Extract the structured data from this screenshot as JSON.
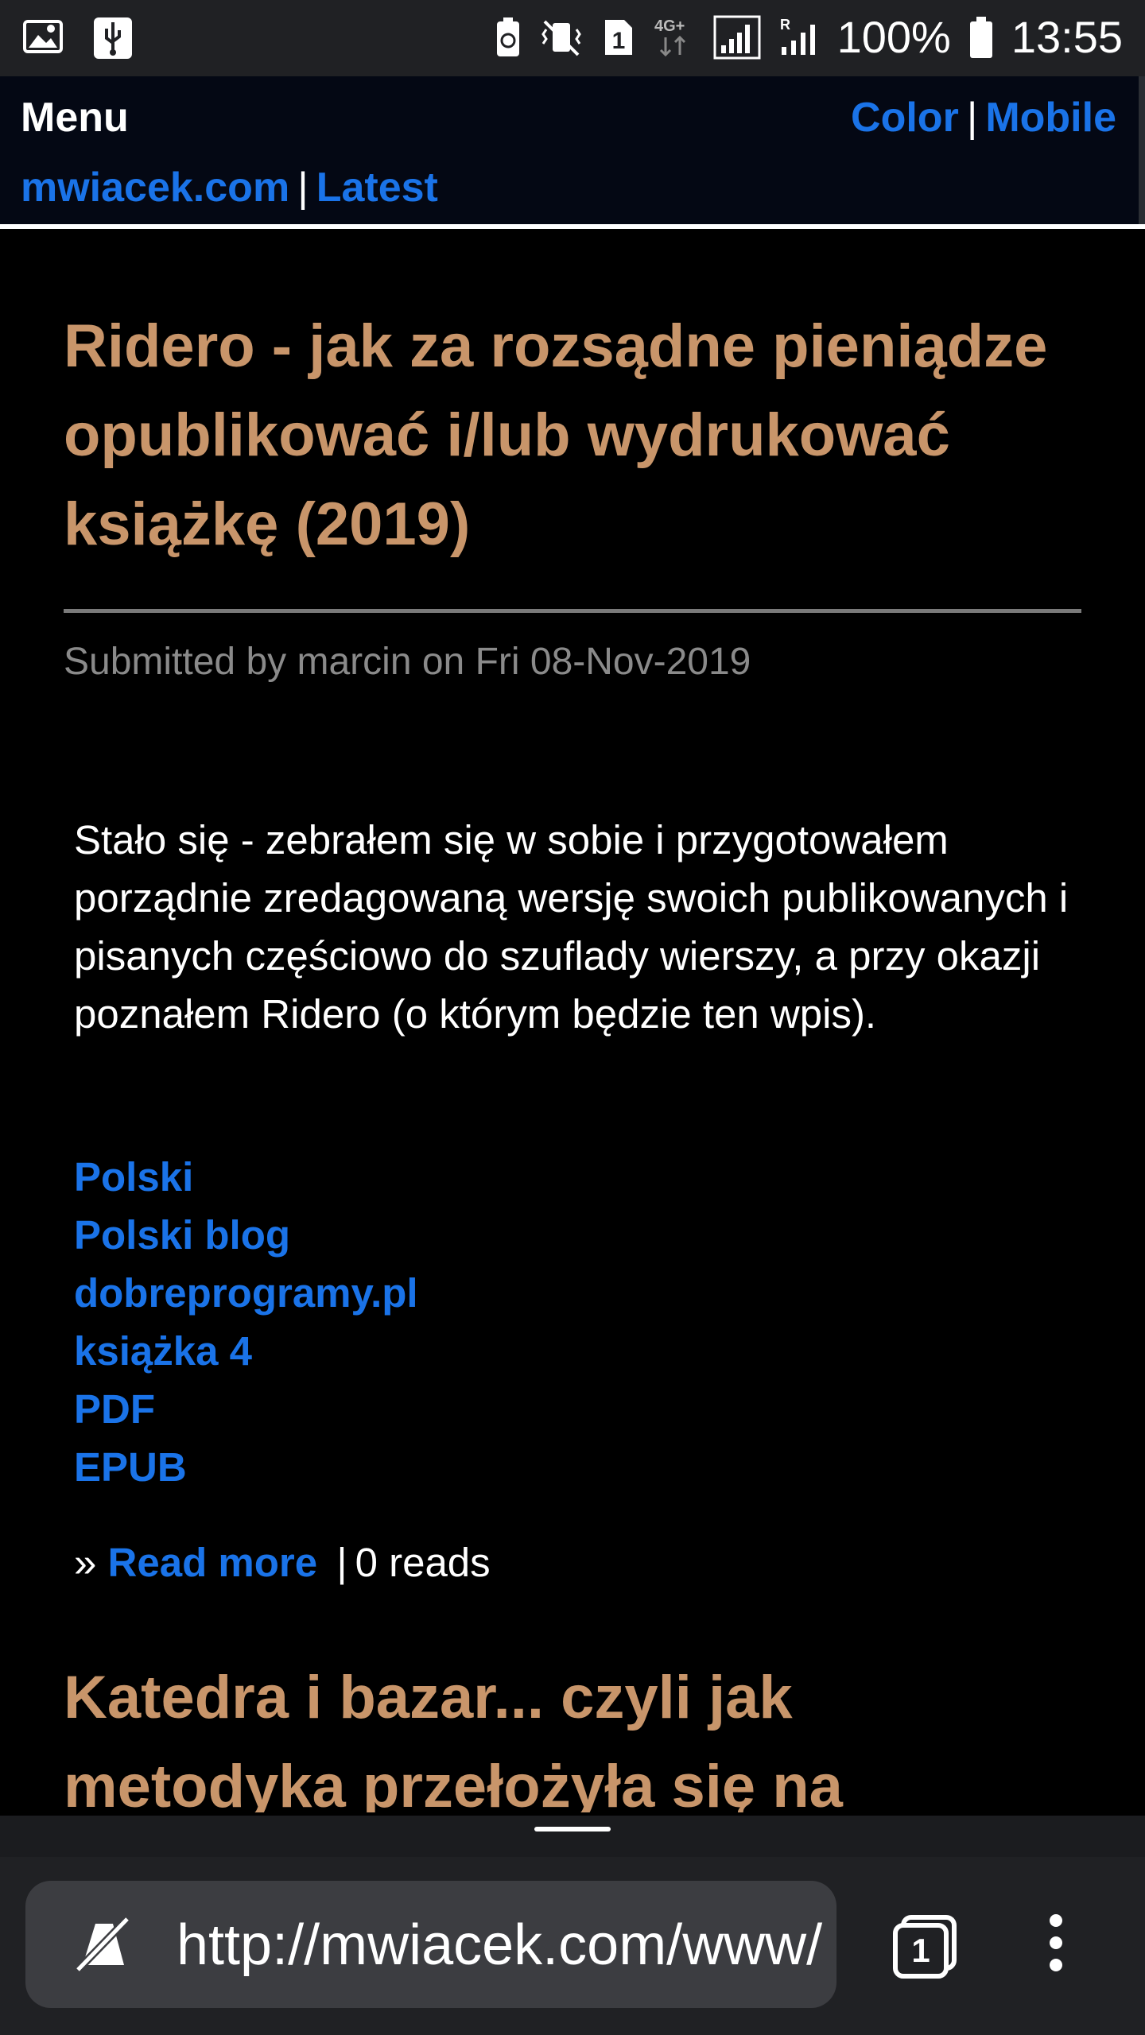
{
  "status_bar": {
    "battery_percent": "100%",
    "time": "13:55",
    "sim_slot": "1",
    "network": "4G+"
  },
  "nav": {
    "menu_label": "Menu",
    "color_link": "Color",
    "mobile_link": "Mobile",
    "home_link": "mwiacek.com",
    "latest_link": "Latest",
    "separator": "|"
  },
  "article": {
    "title": "Ridero - jak za rozsądne pieniądze opublikować i/lub wydrukować książkę (2019)",
    "submitted": "Submitted by marcin on Fri 08-Nov-2019",
    "body": "Stało się - zebrałem się w sobie i przygotowałem porządnie zredagowaną wersję swoich publikowanych i pisanych częściowo do szuflady wierszy, a przy okazji poznałem Ridero (o którym będzie ten wpis).",
    "tags": [
      "Polski",
      "Polski blog",
      "dobreprogramy.pl",
      "książka 4",
      "PDF",
      "EPUB"
    ],
    "read_more_prefix": "»",
    "read_more_label": "Read more",
    "reads_separator": "|",
    "reads_label": "0 reads"
  },
  "next_article": {
    "title": "Katedra i bazar... czyli jak metodyka przełożyła się na"
  },
  "browser": {
    "url": "http://mwiacek.com/www/",
    "tab_count": "1"
  }
}
